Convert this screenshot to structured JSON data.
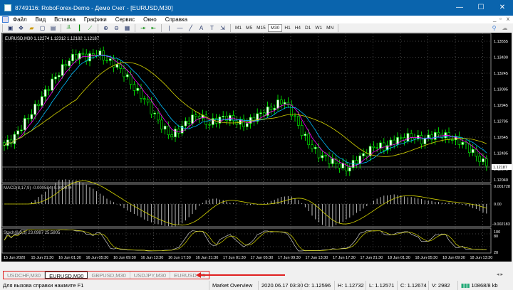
{
  "window": {
    "title": "8749116: RoboForex-Demo - Демо Счет - [EURUSD,M30]",
    "minimize": "—",
    "maximize": "☐",
    "close": "✕"
  },
  "menu": {
    "items": [
      "Файл",
      "Вид",
      "Вставка",
      "Графики",
      "Сервис",
      "Окно",
      "Справка"
    ],
    "mdi": [
      "_",
      "▫",
      "x"
    ]
  },
  "toolbar": {
    "timeframes": [
      "M1",
      "M5",
      "M15",
      "M30",
      "H1",
      "H4",
      "D1",
      "W1",
      "MN"
    ],
    "active_timeframe": "M30"
  },
  "chart": {
    "header": "EURUSD,M30  1.12274 1.12312 1.12182 1.12187",
    "price_labels": [
      "1.13555",
      "1.13400",
      "1.13245",
      "1.13095",
      "1.12945",
      "1.12795",
      "1.12645",
      "1.12495",
      "1.12345",
      "1.12040"
    ],
    "current_price": "1.12187",
    "macd_label": "MACD(8,17,9) -0.000584 -0.000074",
    "macd_scale": [
      "0.001728",
      "0.00",
      "-0.002183"
    ],
    "stoch_label": "Stoch(8,3,3) 23.0987 25.5805",
    "stoch_scale": [
      "100",
      "80",
      "20",
      "0"
    ],
    "time_labels": [
      "15 Jun 2020",
      "15 Jun 21:30",
      "16 Jun 01:30",
      "16 Jun 05:30",
      "16 Jun 09:30",
      "16 Jun 13:30",
      "16 Jun 17:30",
      "16 Jun 21:30",
      "17 Jun 01:30",
      "17 Jun 05:30",
      "17 Jun 09:30",
      "17 Jun 13:30",
      "17 Jun 17:30",
      "17 Jun 21:30",
      "18 Jun 01:30",
      "18 Jun 05:30",
      "18 Jun 09:30",
      "18 Jun 13:30"
    ],
    "colors": {
      "bull": "#00ff00",
      "bull_body": "#ffffff",
      "bear": "#00ff00",
      "bear_body": "#000000",
      "ma_fast": "#ff00ff",
      "ma_mid": "#00bfff",
      "ma_slow": "#d4d400",
      "grid": "#8a8a8a"
    }
  },
  "chart_data": {
    "type": "candlestick",
    "price_min": 1.1204,
    "price_max": 1.13555,
    "close_path": [
      1.124,
      1.1248,
      1.1262,
      1.1275,
      1.129,
      1.1305,
      1.1318,
      1.133,
      1.1336,
      1.1332,
      1.1338,
      1.133,
      1.1325,
      1.1315,
      1.13,
      1.129,
      1.1275,
      1.126,
      1.125,
      1.1258,
      1.1268,
      1.1272,
      1.1262,
      1.1268,
      1.127,
      1.1265,
      1.1262,
      1.127,
      1.1275,
      1.128,
      1.1288,
      1.1275,
      1.1255,
      1.124,
      1.123,
      1.1225,
      1.122,
      1.1215,
      1.1225,
      1.1232,
      1.124,
      1.1238,
      1.1245,
      1.1248,
      1.125,
      1.1245,
      1.125,
      1.1252,
      1.1248,
      1.1245,
      1.1238,
      1.1228,
      1.12187
    ]
  },
  "tabs": [
    {
      "label": "USDCHF,M30"
    },
    {
      "label": "EURUSD,M30"
    },
    {
      "label": "GBPUSD,M30"
    },
    {
      "label": "USDJPY,M30"
    },
    {
      "label": "EURUSD,M5"
    }
  ],
  "active_tab": "EURUSD,M30",
  "status": {
    "help": "Для вызова справки нажмите F1",
    "profile": "Market Overview",
    "datetime": "2020.06.17 03:30",
    "open": "O: 1.12596",
    "high": "H: 1.12732",
    "low": "L: 1.12571",
    "close": "C: 1.12674",
    "volume": "V: 2982",
    "traffic": "10868/8 kb"
  }
}
